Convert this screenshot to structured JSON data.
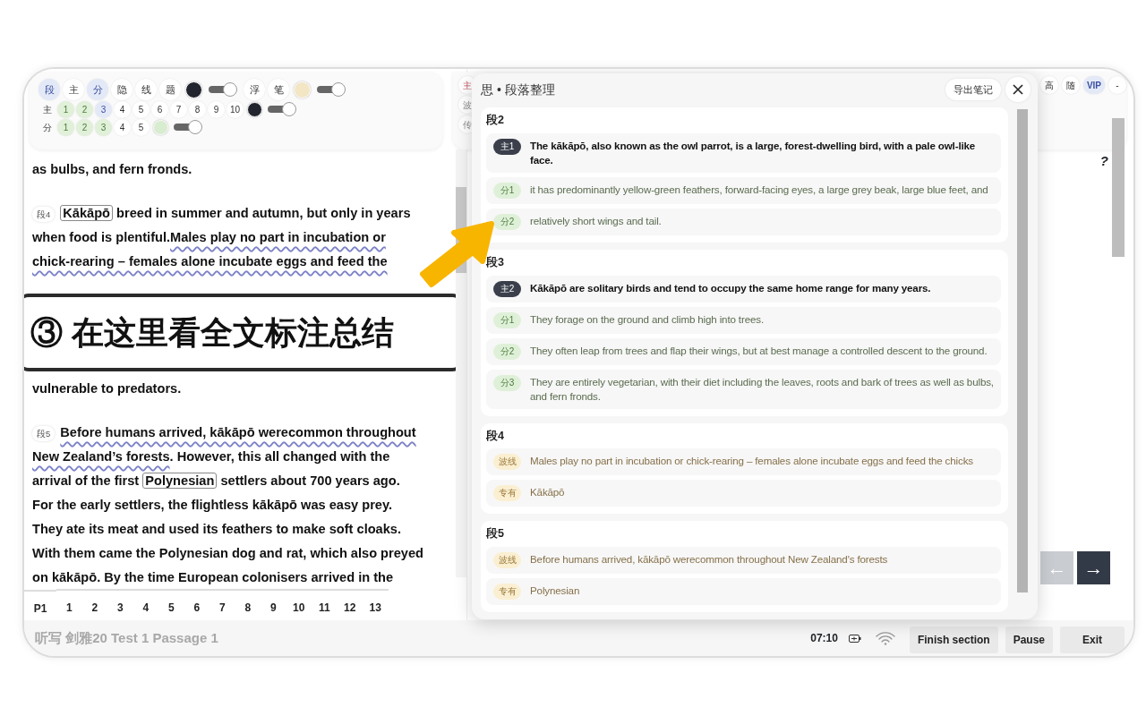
{
  "toolbar": {
    "rows": [
      {
        "items": [
          {
            "kind": "chip",
            "label": "段",
            "selected": true,
            "marked": false
          },
          {
            "kind": "chip",
            "label": "主",
            "selected": false,
            "marked": false
          },
          {
            "kind": "chip",
            "label": "分",
            "selected": true,
            "marked": false
          },
          {
            "kind": "chip",
            "label": "隐",
            "selected": false,
            "marked": false
          },
          {
            "kind": "chip",
            "label": "线",
            "selected": false,
            "marked": false
          },
          {
            "kind": "chip",
            "label": "题",
            "selected": false,
            "marked": false
          },
          {
            "kind": "swatch",
            "color": "#22252d"
          },
          {
            "kind": "toggle",
            "on": true
          },
          {
            "kind": "chip",
            "label": "浮",
            "selected": false,
            "marked": false
          },
          {
            "kind": "chip",
            "label": "笔",
            "selected": false,
            "marked": false
          },
          {
            "kind": "swatch",
            "color": "#f3e6c4"
          },
          {
            "kind": "toggle",
            "on": true
          }
        ]
      },
      {
        "items": [
          {
            "kind": "label",
            "label": "主"
          },
          {
            "kind": "chip",
            "label": "1",
            "selected": false,
            "marked": true
          },
          {
            "kind": "chip",
            "label": "2",
            "selected": false,
            "marked": true
          },
          {
            "kind": "chip",
            "label": "3",
            "selected": true,
            "marked": false
          },
          {
            "kind": "chip",
            "label": "4",
            "selected": false,
            "marked": false
          },
          {
            "kind": "chip",
            "label": "5",
            "selected": false,
            "marked": false
          },
          {
            "kind": "chip",
            "label": "6",
            "selected": false,
            "marked": false
          },
          {
            "kind": "chip",
            "label": "7",
            "selected": false,
            "marked": false
          },
          {
            "kind": "chip",
            "label": "8",
            "selected": false,
            "marked": false
          },
          {
            "kind": "chip",
            "label": "9",
            "selected": false,
            "marked": false
          },
          {
            "kind": "chip",
            "label": "10",
            "selected": false,
            "marked": false
          },
          {
            "kind": "swatch",
            "color": "#22252d"
          },
          {
            "kind": "toggle",
            "on": true
          }
        ]
      },
      {
        "items": [
          {
            "kind": "label",
            "label": "分"
          },
          {
            "kind": "chip",
            "label": "1",
            "selected": false,
            "marked": true
          },
          {
            "kind": "chip",
            "label": "2",
            "selected": false,
            "marked": true
          },
          {
            "kind": "chip",
            "label": "3",
            "selected": false,
            "marked": true
          },
          {
            "kind": "chip",
            "label": "4",
            "selected": false,
            "marked": false
          },
          {
            "kind": "chip",
            "label": "5",
            "selected": false,
            "marked": false
          },
          {
            "kind": "swatch",
            "color": "#d8ecd0"
          },
          {
            "kind": "toggle",
            "on": true
          }
        ]
      }
    ]
  },
  "passage": {
    "before": [
      {
        "lines": [
          [
            {
              "kind": "plain",
              "text": "as bulbs, and fern fronds."
            }
          ]
        ]
      },
      {
        "label": "段4",
        "lines": [
          [
            {
              "kind": "boxed",
              "text": "Kākāpō"
            },
            {
              "kind": "plain",
              "text": " breed in summer and autumn, but only in years"
            }
          ],
          [
            {
              "kind": "plain",
              "text": "when food is plentiful."
            },
            {
              "kind": "wavy",
              "text": "Males play no part in incubation or"
            }
          ],
          [
            {
              "kind": "wavy",
              "text": "chick-rearing – females alone incubate eggs and feed the"
            }
          ]
        ]
      }
    ],
    "after": [
      {
        "lines": [
          [
            {
              "kind": "plain",
              "text": "vulnerable to predators."
            }
          ]
        ]
      },
      {
        "label": "段5",
        "lines": [
          [
            {
              "kind": "wavy",
              "text": "Before humans arrived, kākāpō werecommon throughout"
            }
          ],
          [
            {
              "kind": "wavy",
              "text": "New Zealand’s forests"
            },
            {
              "kind": "plain",
              "text": ". However, this all changed with the"
            }
          ],
          [
            {
              "kind": "plain",
              "text": "arrival of the first "
            },
            {
              "kind": "boxed",
              "text": "Polynesian"
            },
            {
              "kind": "plain",
              "text": " settlers about 700 years ago."
            }
          ],
          [
            {
              "kind": "plain",
              "text": "For the early settlers, the flightless kākāpō was easy prey."
            }
          ],
          [
            {
              "kind": "plain",
              "text": "They ate its meat and used its feathers to make soft cloaks."
            }
          ],
          [
            {
              "kind": "plain",
              "text": "With them came the Polynesian dog and rat, which also preyed"
            }
          ],
          [
            {
              "kind": "plain",
              "text": "on kākāpō. By the time European colonisers arrived in the"
            }
          ]
        ]
      }
    ]
  },
  "callout": {
    "text": "③ 在这里看全文标注总结"
  },
  "pages": {
    "label": "P1",
    "items": [
      "1",
      "2",
      "3",
      "4",
      "5",
      "6",
      "7",
      "8",
      "9",
      "10",
      "11",
      "12",
      "13"
    ]
  },
  "side_tools": [
    {
      "label": "主",
      "selected": true
    },
    {
      "label": "波",
      "selected": false
    },
    {
      "label": "传",
      "selected": false
    }
  ],
  "right_tools": [
    {
      "label": "高",
      "selected": false
    },
    {
      "label": "随",
      "selected": false
    },
    {
      "label": "VIP",
      "selected": true
    },
    {
      "label": "-",
      "selected": false
    }
  ],
  "question_mark": "?",
  "nav": {
    "prev": {
      "label": "←",
      "disabled": true
    },
    "next": {
      "label": "→",
      "disabled": false
    }
  },
  "panel": {
    "title": "思 • 段落整理",
    "export": "导出笔记",
    "sections": [
      {
        "title": "段2",
        "items": [
          {
            "kind": "main",
            "tag": "主1",
            "text": "The kākāpō, also known as the owl parrot, is a large, forest-dwelling bird, with a pale owl-like face."
          },
          {
            "kind": "sub",
            "tag": "分1",
            "text": "it has predominantly yellow-green feathers, forward-facing eyes, a large grey beak, large blue feet, and"
          },
          {
            "kind": "sub",
            "tag": "分2",
            "text": "relatively short wings and tail."
          }
        ]
      },
      {
        "title": "段3",
        "items": [
          {
            "kind": "main",
            "tag": "主2",
            "text": "Kākāpō are solitary birds and tend to occupy the same home range for many years."
          },
          {
            "kind": "sub",
            "tag": "分1",
            "text": "They forage on the ground and climb high into trees."
          },
          {
            "kind": "sub",
            "tag": "分2",
            "text": "They often leap from trees and flap their wings, but at best manage a controlled descent to the ground."
          },
          {
            "kind": "sub",
            "tag": "分3",
            "text": "They are entirely vegetarian, with their diet including the leaves, roots and bark of trees as well as bulbs, and fern fronds."
          }
        ]
      },
      {
        "title": "段4",
        "items": [
          {
            "kind": "note",
            "tag": "波线",
            "text": "Males play no part in incubation or chick-rearing – females alone incubate eggs and feed the chicks"
          },
          {
            "kind": "note",
            "tag": "专有",
            "text": "Kākāpō"
          }
        ]
      },
      {
        "title": "段5",
        "items": [
          {
            "kind": "note",
            "tag": "波线",
            "text": "Before humans arrived, kākāpō werecommon throughout New Zealand's forests"
          },
          {
            "kind": "note",
            "tag": "专有",
            "text": "Polynesian"
          }
        ]
      }
    ]
  },
  "status_bar": {
    "title": "听写 剑雅20 Test 1 Passage 1",
    "time": "07:10",
    "buttons": [
      "Finish section",
      "Pause",
      "Exit"
    ]
  }
}
